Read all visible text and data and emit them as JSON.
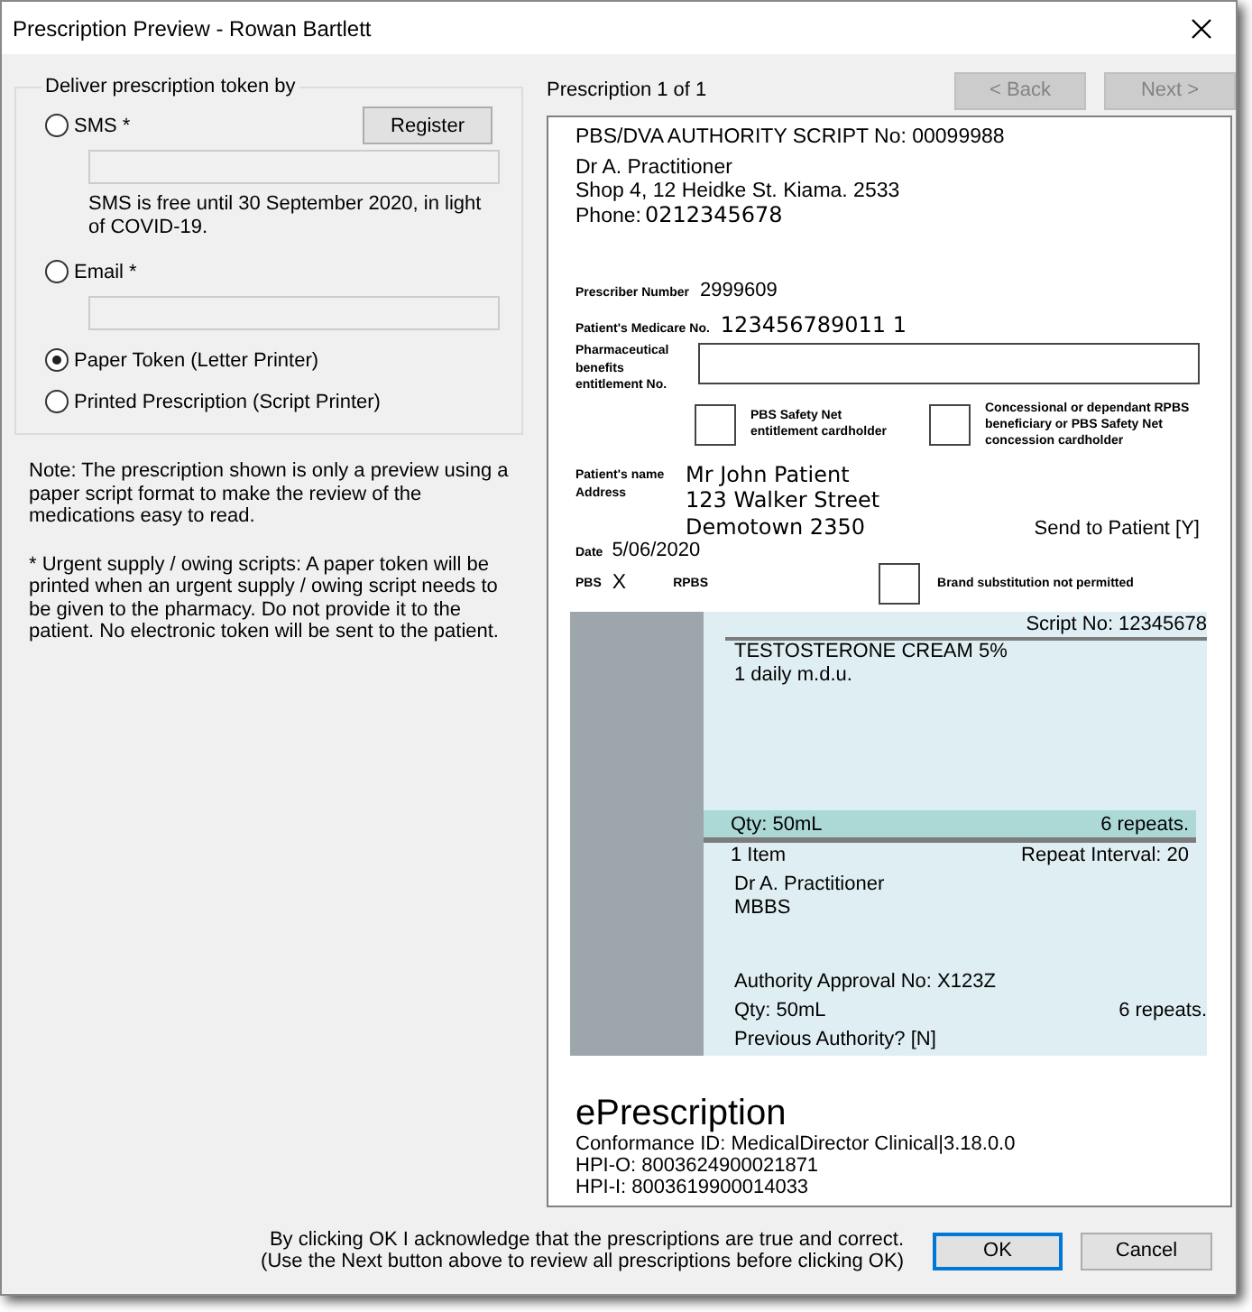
{
  "window": {
    "title": "Prescription Preview - Rowan Bartlett"
  },
  "delivery": {
    "legend": "Deliver prescription token by",
    "register_button": "Register",
    "options": [
      {
        "kind": "field",
        "label": "SMS *",
        "selected": false,
        "note": "SMS is free until 30 September 2020, in light of COVID-19."
      },
      {
        "kind": "field",
        "label": "Email *",
        "selected": false
      },
      {
        "kind": "plain",
        "label": "Paper Token (Letter Printer)",
        "selected": true
      },
      {
        "kind": "plain",
        "label": "Printed Prescription (Script Printer)",
        "selected": false
      }
    ]
  },
  "notes": [
    "Note: The prescription shown is only a preview using a paper script format to make the review of the medications easy to read.",
    "* Urgent supply / owing scripts: A paper token will be printed when an urgent supply / owing script needs to be given to the pharmacy. Do not provide it to the patient. No electronic token will be sent to the patient."
  ],
  "preview": {
    "counter": "Prescription 1 of 1",
    "back_button": {
      "label": "< Back",
      "disabled": true
    },
    "next_button": {
      "label": "Next >",
      "disabled": true
    }
  },
  "script": {
    "heading": "PBS/DVA AUTHORITY SCRIPT No: 00099988",
    "prescriber_name": "Dr A. Practitioner",
    "prescriber_address": "Shop 4, 12 Heidke St. Kiama. 2533",
    "phone_label": "Phone:",
    "phone": "0212345678",
    "prescriber_number_label": "Prescriber Number",
    "prescriber_number": "2999609",
    "medicare_label": "Patient's Medicare No.",
    "medicare": "123456789011 1",
    "entitlement_label": "Pharmaceutical benefits entitlement No.",
    "cardholder_boxes": [
      {
        "label": "PBS Safety Net entitlement cardholder",
        "checked": false
      },
      {
        "label": "Concessional or dependant RPBS beneficiary or PBS Safety Net concession cardholder",
        "checked": false
      }
    ],
    "patient_name_label": "Patient's name",
    "address_label": "Address",
    "patient_name": "Mr John Patient",
    "patient_address_lines": [
      "123 Walker Street",
      "Demotown 2350"
    ],
    "send_to_patient": "Send to Patient [Y]",
    "date_label": "Date",
    "date": "5/06/2020",
    "pbs_label": "PBS",
    "pbs_mark": "X",
    "rpbs_label": "RPBS",
    "brand_substitution": {
      "label": "Brand substitution not permitted",
      "checked": false
    },
    "item": {
      "script_no": "Script No: 12345678",
      "drug": "TESTOSTERONE CREAM 5%",
      "directions": "1 daily m.d.u.",
      "qty": "Qty: 50mL",
      "repeats": "6 repeats.",
      "count": "1 Item",
      "repeat_interval": "Repeat Interval: 20",
      "doctor": "Dr A. Practitioner",
      "qualification": "MBBS",
      "authority": "Authority Approval No: X123Z",
      "qty_2": "Qty: 50mL",
      "repeats_2": "6 repeats.",
      "previous_authority": "Previous Authority? [N]"
    },
    "eprescription_title": "ePrescription",
    "conformance": "Conformance ID: MedicalDirector Clinical|3.18.0.0",
    "hpi_o": "HPI-O: 8003624900021871",
    "hpi_i": "HPI-I: 8003619900014033"
  },
  "footer": {
    "acknowledgement": [
      "By clicking OK I acknowledge that the prescriptions are true and correct.",
      "(Use the Next button above to review all prescriptions before clicking OK)"
    ],
    "ok_button": "OK",
    "cancel_button": "Cancel"
  }
}
